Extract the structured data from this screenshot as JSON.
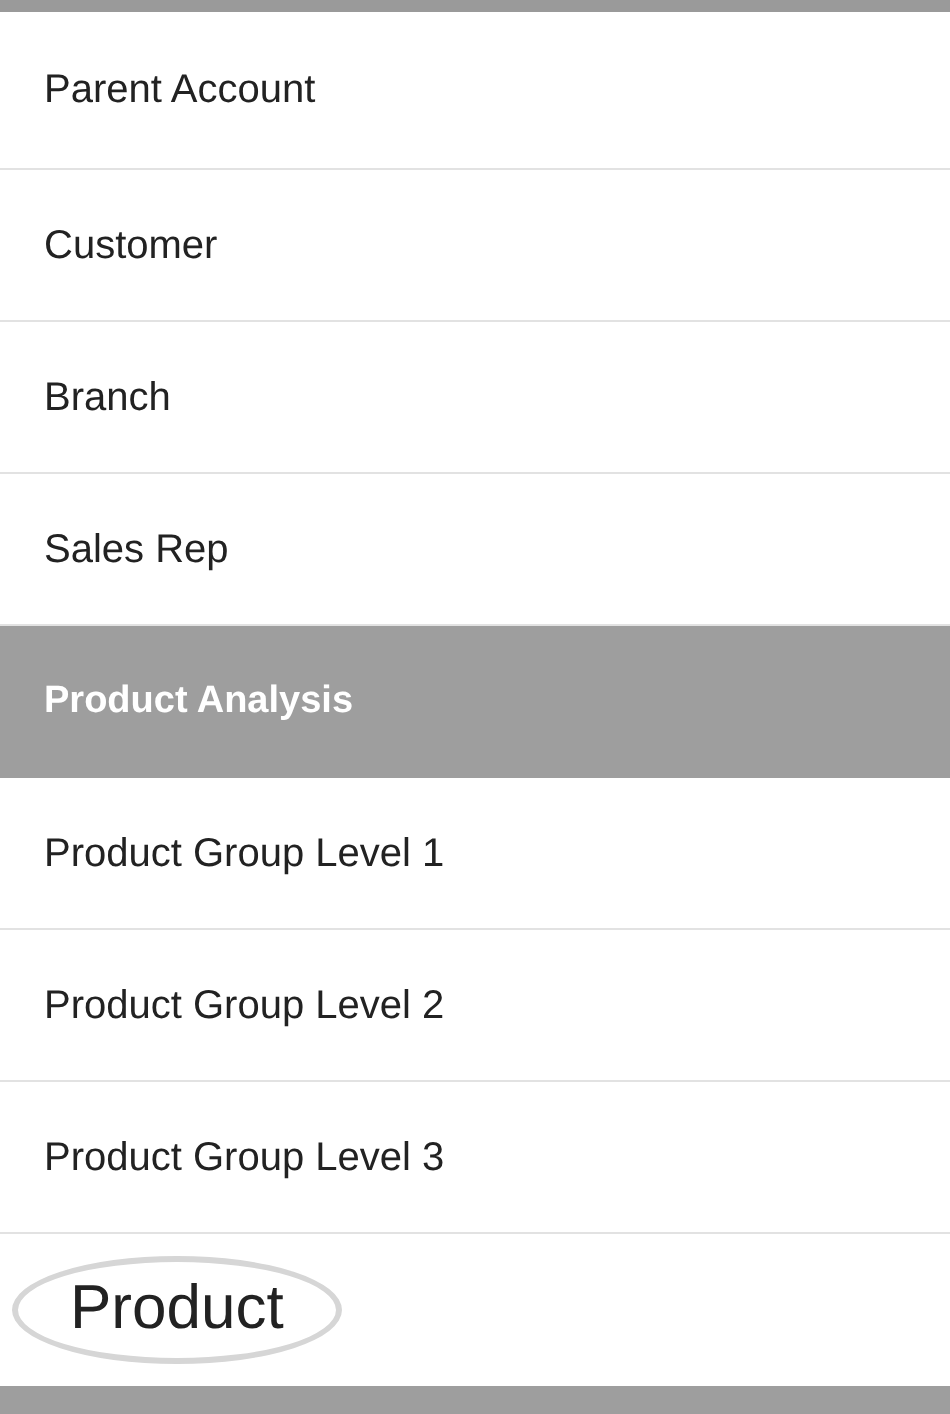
{
  "items": [
    {
      "kind": "item",
      "label": "Parent Account",
      "circled": false
    },
    {
      "kind": "item",
      "label": "Customer",
      "circled": false
    },
    {
      "kind": "item",
      "label": "Branch",
      "circled": false
    },
    {
      "kind": "item",
      "label": "Sales Rep",
      "circled": false
    },
    {
      "kind": "header",
      "label": "Product Analysis",
      "circled": false
    },
    {
      "kind": "item",
      "label": "Product Group Level 1",
      "circled": false
    },
    {
      "kind": "item",
      "label": "Product Group Level 2",
      "circled": false
    },
    {
      "kind": "item",
      "label": "Product Group Level 3",
      "circled": false
    },
    {
      "kind": "item",
      "label": "Product",
      "circled": true
    }
  ]
}
